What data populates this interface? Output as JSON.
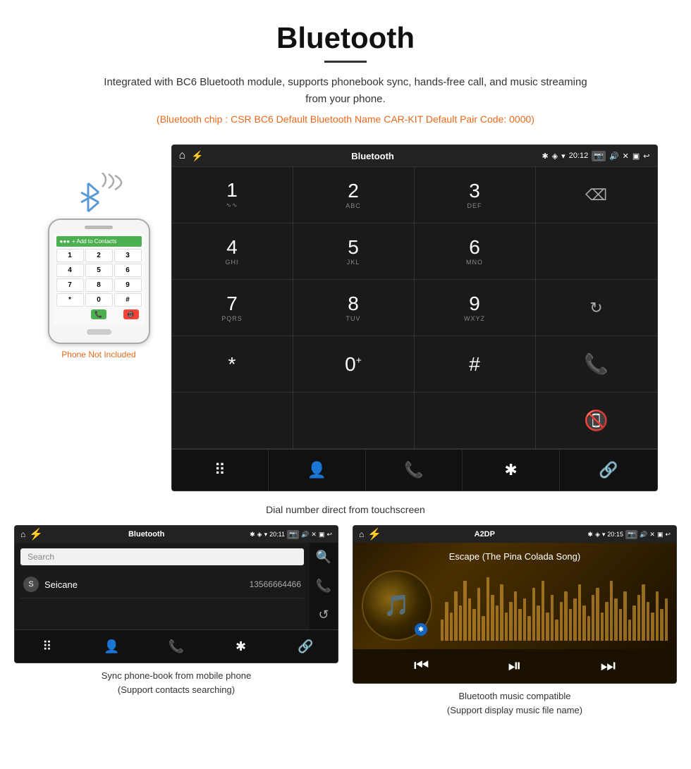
{
  "header": {
    "title": "Bluetooth",
    "underline": true,
    "description": "Integrated with BC6 Bluetooth module, supports phonebook sync, hands-free call, and music streaming from your phone.",
    "info_line": "(Bluetooth chip : CSR BC6    Default Bluetooth Name CAR-KIT    Default Pair Code: 0000)"
  },
  "dial_screen": {
    "status_bar": {
      "home_icon": "⌂",
      "app_title": "Bluetooth",
      "usb_icon": "⚡",
      "bluetooth_icon": "✱",
      "location_icon": "◈",
      "wifi_icon": "▾",
      "time": "20:12",
      "camera_icon": "📷",
      "volume_icon": "🔊",
      "close_icon": "✕",
      "window_icon": "▣",
      "back_icon": "↩"
    },
    "keypad": [
      {
        "main": "1",
        "sub": "∿∿",
        "col": 1,
        "row": 1
      },
      {
        "main": "2",
        "sub": "ABC",
        "col": 2,
        "row": 1
      },
      {
        "main": "3",
        "sub": "DEF",
        "col": 3,
        "row": 1
      },
      {
        "main": "",
        "sub": "",
        "col": 4,
        "row": 1,
        "special": "delete"
      },
      {
        "main": "4",
        "sub": "GHI",
        "col": 1,
        "row": 2
      },
      {
        "main": "5",
        "sub": "JKL",
        "col": 2,
        "row": 2
      },
      {
        "main": "6",
        "sub": "MNO",
        "col": 3,
        "row": 2
      },
      {
        "main": "",
        "sub": "",
        "col": 4,
        "row": 2,
        "special": "empty"
      },
      {
        "main": "7",
        "sub": "PQRS",
        "col": 1,
        "row": 3
      },
      {
        "main": "8",
        "sub": "TUV",
        "col": 2,
        "row": 3
      },
      {
        "main": "9",
        "sub": "WXYZ",
        "col": 3,
        "row": 3
      },
      {
        "main": "",
        "sub": "",
        "col": 4,
        "row": 3,
        "special": "refresh"
      },
      {
        "main": "*",
        "sub": "",
        "col": 1,
        "row": 4
      },
      {
        "main": "0",
        "sub": "+",
        "col": 2,
        "row": 4
      },
      {
        "main": "#",
        "sub": "",
        "col": 3,
        "row": 4
      },
      {
        "main": "",
        "sub": "",
        "col": 4,
        "row": 4,
        "special": "call-green"
      },
      {
        "main": "",
        "sub": "",
        "col": 4,
        "row": 4,
        "special": "call-red"
      }
    ],
    "bottom_bar": [
      "⠿",
      "👤",
      "📞",
      "✱",
      "🔗"
    ],
    "caption": "Dial number direct from touchscreen"
  },
  "phonebook_screen": {
    "status_bar": {
      "title": "Bluetooth",
      "time": "20:11"
    },
    "search_placeholder": "Search",
    "contacts": [
      {
        "letter": "S",
        "name": "Seicane",
        "phone": "13566664466"
      }
    ],
    "sidebar_icons": [
      "🔍",
      "📞",
      "↺"
    ],
    "bottom_bar": [
      "⠿",
      "👤",
      "📞",
      "✱",
      "🔗"
    ],
    "caption_line1": "Sync phone-book from mobile phone",
    "caption_line2": "(Support contacts searching)"
  },
  "music_screen": {
    "status_bar": {
      "title": "A2DP",
      "time": "20:15"
    },
    "song_title": "Escape (The Pina Colada Song)",
    "controls": [
      "⏮",
      "⏯",
      "⏭"
    ],
    "caption_line1": "Bluetooth music compatible",
    "caption_line2": "(Support display music file name)"
  },
  "phone_illustration": {
    "not_included_text": "Phone Not Included",
    "add_to_contacts": "+ Add to Contacts",
    "keys": [
      "1",
      "2",
      "3",
      "4",
      "5",
      "6",
      "7",
      "8",
      "9",
      "*",
      "0",
      "#"
    ]
  }
}
